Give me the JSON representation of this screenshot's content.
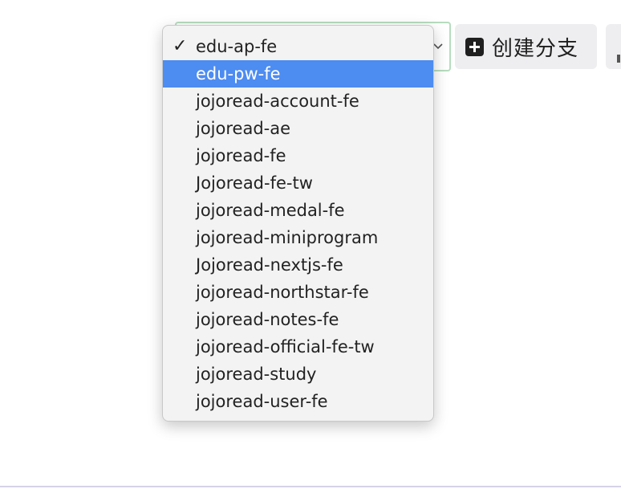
{
  "repo_select": {
    "selected_value": "edu-ap-fe",
    "highlighted_value": "edu-pw-fe",
    "options": [
      {
        "label": "edu-ap-fe",
        "checked": true,
        "highlighted": false
      },
      {
        "label": "edu-pw-fe",
        "checked": false,
        "highlighted": true
      },
      {
        "label": "jojoread-account-fe",
        "checked": false,
        "highlighted": false
      },
      {
        "label": "jojoread-ae",
        "checked": false,
        "highlighted": false
      },
      {
        "label": "jojoread-fe",
        "checked": false,
        "highlighted": false
      },
      {
        "label": "Jojoread-fe-tw",
        "checked": false,
        "highlighted": false
      },
      {
        "label": "jojoread-medal-fe",
        "checked": false,
        "highlighted": false
      },
      {
        "label": "jojoread-miniprogram",
        "checked": false,
        "highlighted": false
      },
      {
        "label": "Jojoread-nextjs-fe",
        "checked": false,
        "highlighted": false
      },
      {
        "label": "jojoread-northstar-fe",
        "checked": false,
        "highlighted": false
      },
      {
        "label": "jojoread-notes-fe",
        "checked": false,
        "highlighted": false
      },
      {
        "label": "jojoread-official-fe-tw",
        "checked": false,
        "highlighted": false
      },
      {
        "label": "jojoread-study",
        "checked": false,
        "highlighted": false
      },
      {
        "label": "jojoread-user-fe",
        "checked": false,
        "highlighted": false
      }
    ],
    "check_icon": "checkmark-icon",
    "chevron_icon": "chevron-down-icon"
  },
  "toolbar": {
    "create_branch_label": "创建分支",
    "create_branch_icon": "plus-square-icon"
  },
  "colors": {
    "highlight": "#4d8cf1",
    "select_border": "#b6dcbf",
    "button_bg": "#eeeef0"
  }
}
